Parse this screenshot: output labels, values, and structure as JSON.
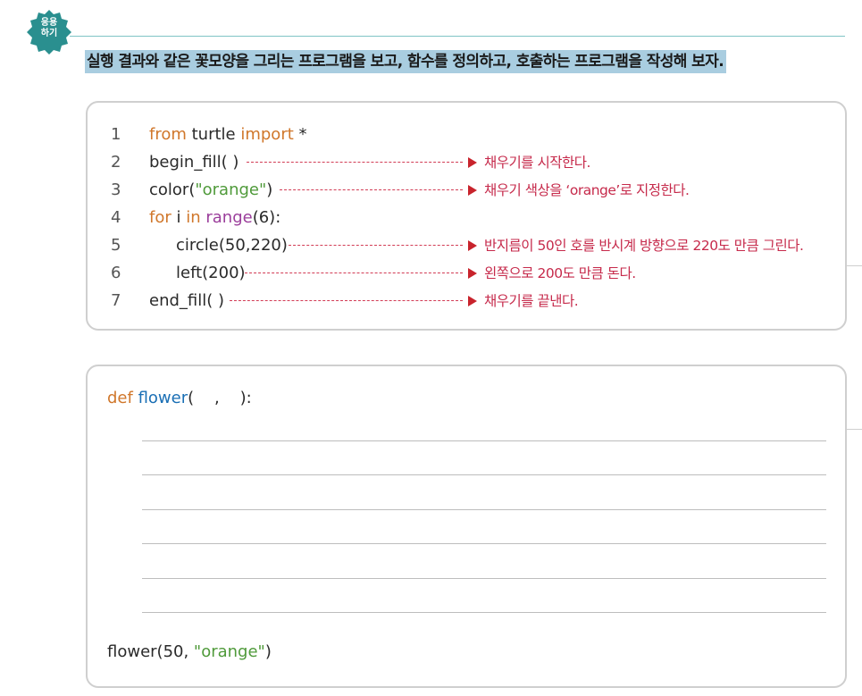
{
  "badge": {
    "line1": "응용",
    "line2": "하기",
    "color": "#2a8f8f"
  },
  "heading": "실행 결과와 같은 꽃모양을 그리는 프로그램을 보고, 함수를 정의하고, 호출하는 프로그램을 작성해 보자.",
  "code_lines": [
    {
      "num": "1",
      "kw1": "from",
      "mid": " turtle ",
      "kw2": "import",
      "tail": "  *"
    },
    {
      "num": "2",
      "text": "begin_fill( )",
      "note": "채우기를 시작한다."
    },
    {
      "num": "3",
      "fn": "color(",
      "str": "\"orange\"",
      "close": ")",
      "note": "채우기 색상을 ‘orange’로 지정한다."
    },
    {
      "num": "4",
      "kw1": "for",
      "mid1": " i ",
      "kw2": "in",
      "sp": " ",
      "bi": "range",
      "tail": "(6):"
    },
    {
      "num": "5",
      "text": "circle(50,220)",
      "note": "반지름이 50인 호를 반시계 방향으로 220도 만큼 그린다."
    },
    {
      "num": "6",
      "text": "left(200)",
      "note": "왼쪽으로 200도 만큼 돈다."
    },
    {
      "num": "7",
      "text": "end_fill( )",
      "note": "채우기를 끝낸다."
    }
  ],
  "answer": {
    "def_kw": "def",
    "func_name": "flower",
    "params": "(    ,    ):",
    "call_name": "flower(50, ",
    "call_str": "\"orange\"",
    "call_close": ")"
  }
}
